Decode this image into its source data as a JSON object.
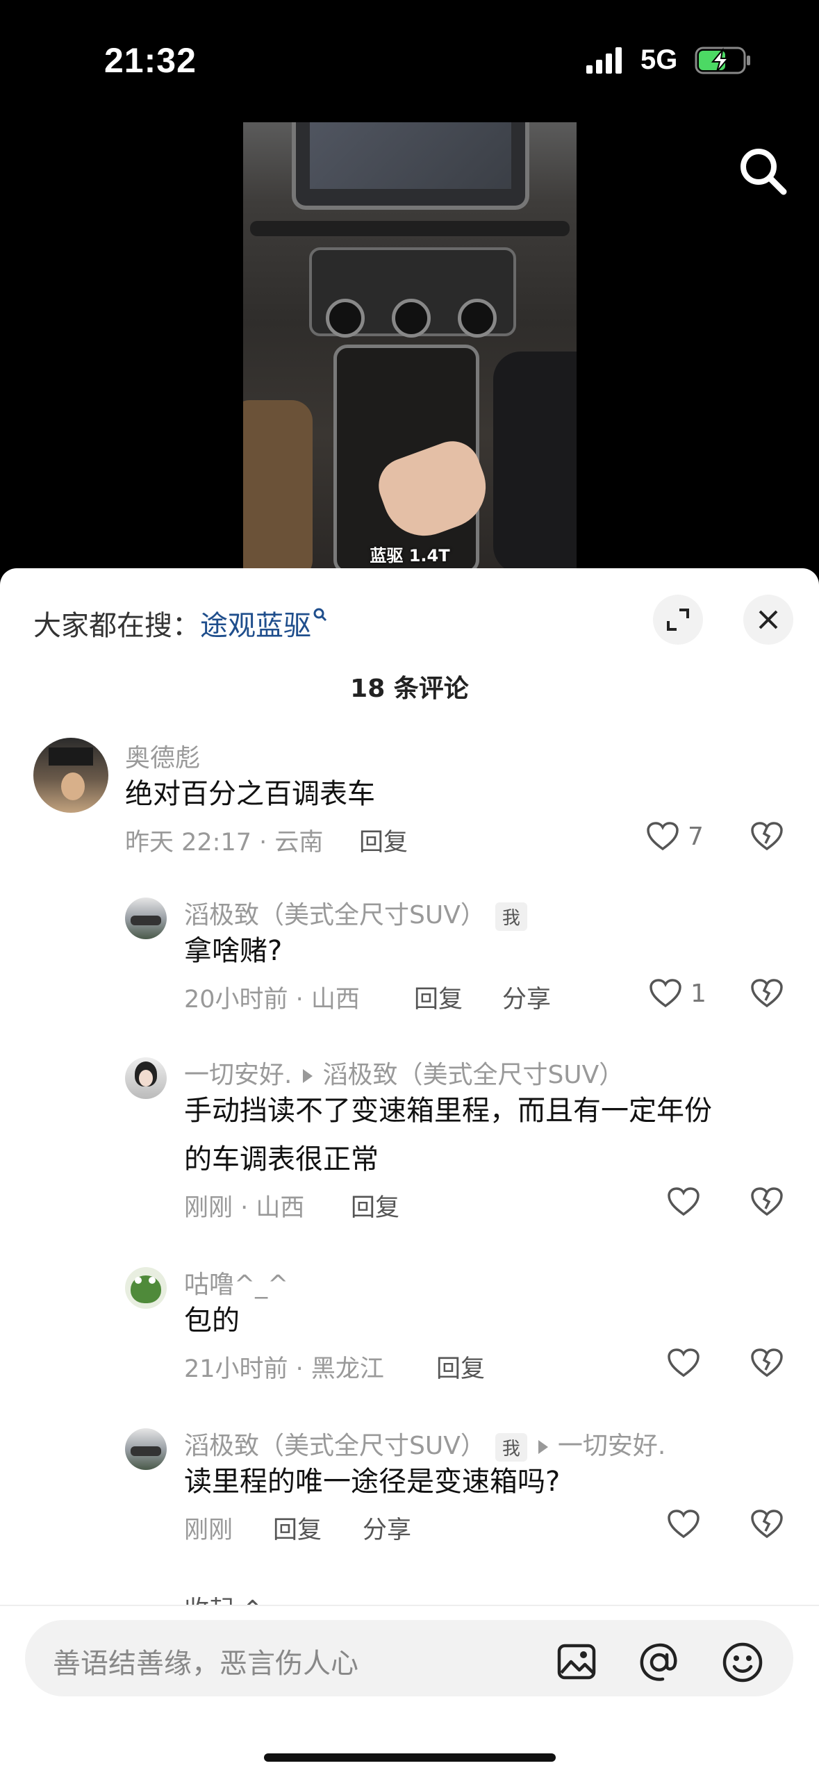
{
  "status_bar": {
    "time": "21:32",
    "network": "5G"
  },
  "video": {
    "caption": "蓝驱 1.4T"
  },
  "sheet": {
    "hot_search_label": "大家都在搜：",
    "hot_search_keyword": "途观蓝驱",
    "comment_count": "18 条评论",
    "comments": [
      {
        "user": "奥德彪",
        "text": "绝对百分之百调表车",
        "meta": "昨天 22:17 · 云南",
        "reply": "回复",
        "likes": "7"
      },
      {
        "user": "滔极致（美式全尺寸SUV）",
        "tag": "我",
        "text": "拿啥赌?",
        "meta": "20小时前 · 山西",
        "reply": "回复",
        "share": "分享",
        "likes": "1"
      },
      {
        "user": "一切安好.",
        "reply_to": "滔极致（美式全尺寸SUV）",
        "text_line1": "手动挡读不了变速箱里程，而且有一定年份",
        "text_line2": "的车调表很正常",
        "meta": "刚刚 · 山西",
        "reply": "回复"
      },
      {
        "user": "咕噜^_^",
        "text": "包的",
        "meta": "21小时前 · 黑龙江",
        "reply": "回复"
      },
      {
        "user": "滔极致（美式全尺寸SUV）",
        "tag": "我",
        "reply_to": "一切安好.",
        "text": "读里程的唯一途径是变速箱吗?",
        "meta": "刚刚",
        "reply": "回复",
        "share": "分享"
      }
    ],
    "collapse_label": "收起 ⌃"
  },
  "input": {
    "placeholder": "善语结善缘，恶言伤人心"
  },
  "icons": [
    "search-icon",
    "expand-icon",
    "close-icon",
    "heart-icon",
    "dislike-icon",
    "image-icon",
    "at-icon",
    "emoji-icon"
  ]
}
